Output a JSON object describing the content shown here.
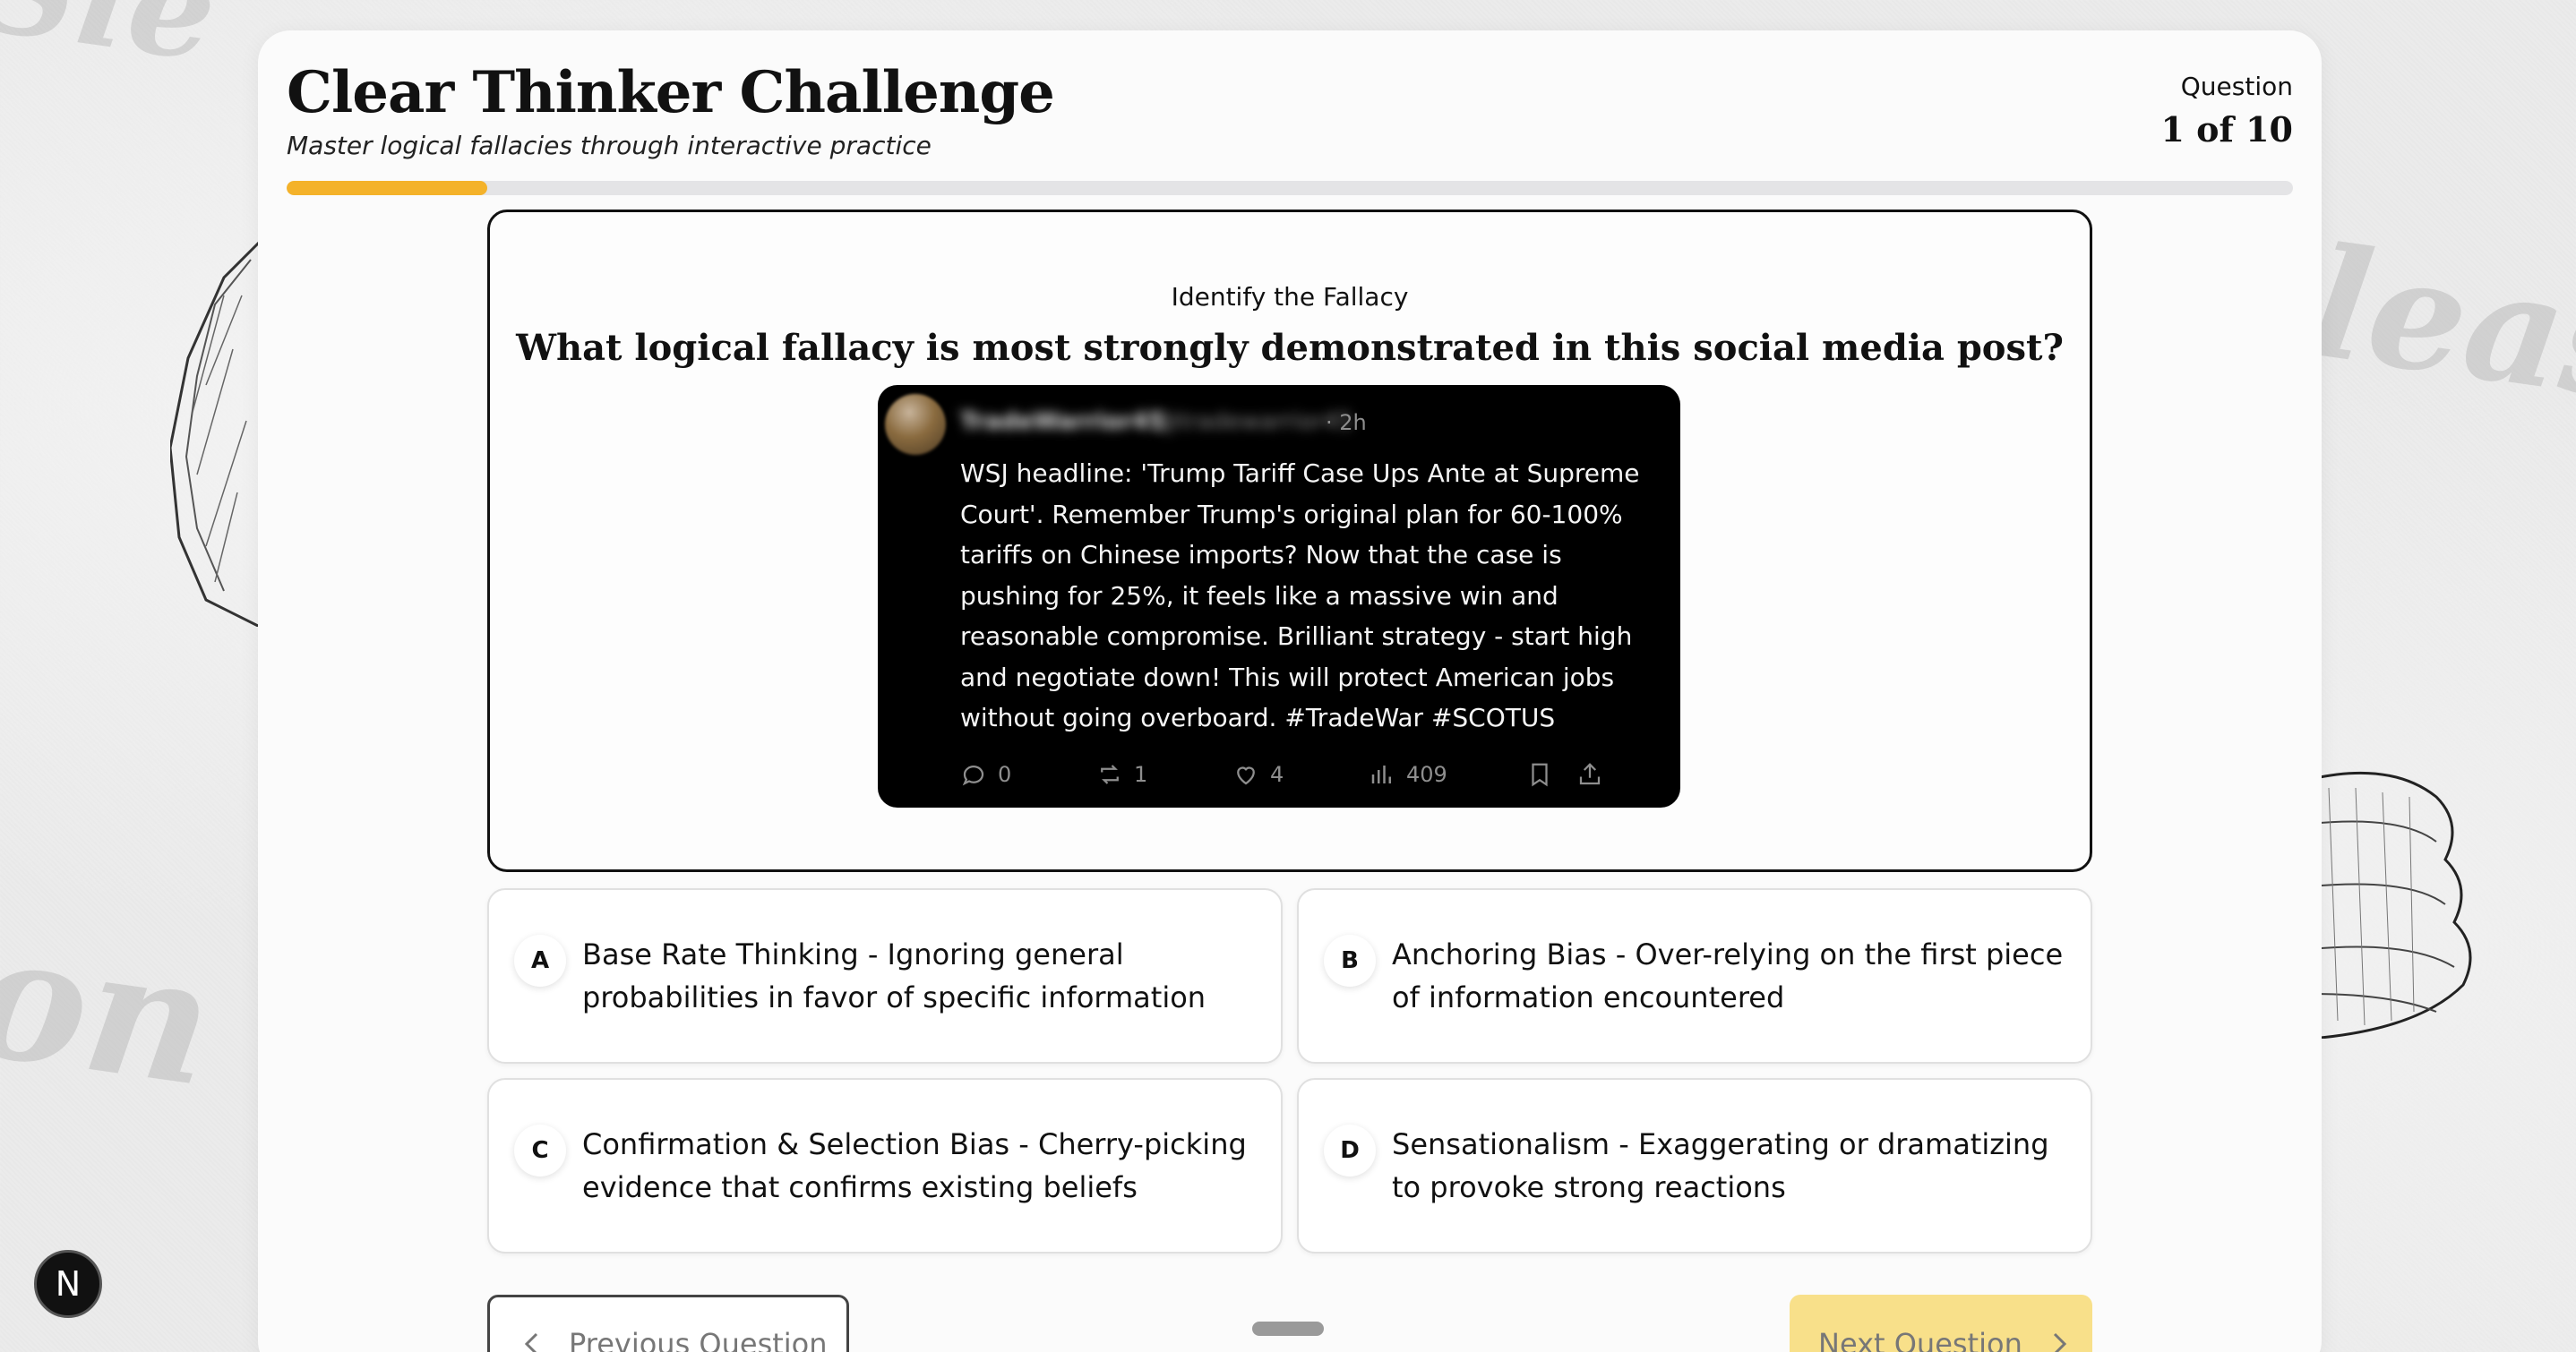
{
  "header": {
    "title": "Clear Thinker Challenge",
    "subtitle": "Master logical fallacies through interactive practice",
    "question_label": "Question",
    "question_count": "1 of 10",
    "progress_fraction": 0.1
  },
  "question": {
    "kicker": "Identify the Fallacy",
    "text": "What logical fallacy is most strongly demonstrated in this social media post?"
  },
  "post": {
    "display_name": "TradeWarrior45",
    "handle": "@tradewarrior45",
    "time": "· 2h",
    "text": "WSJ headline: 'Trump Tariff Case Ups Ante at Supreme Court'. Remember Trump's original plan for 60-100% tariffs on Chinese imports? Now that the case is pushing for 25%, it feels like a massive win and reasonable compromise. Brilliant strategy - start high and negotiate down! This will protect American jobs without going overboard. #TradeWar #SCOTUS",
    "replies": "0",
    "reposts": "1",
    "likes": "4",
    "views": "409"
  },
  "options": [
    {
      "letter": "A",
      "text": "Base Rate Thinking - Ignoring general probabilities in favor of specific information"
    },
    {
      "letter": "B",
      "text": "Anchoring Bias - Over-relying on the first piece of information encountered"
    },
    {
      "letter": "C",
      "text": "Confirmation & Selection Bias - Cherry-picking evidence that confirms existing beliefs"
    },
    {
      "letter": "D",
      "text": "Sensationalism - Exaggerating or dramatizing to provoke strong reactions"
    }
  ],
  "nav": {
    "prev_label": "Previous Question",
    "next_label": "Next Question"
  },
  "background": {
    "word_top": "Sle",
    "word_right": "lease",
    "word_left": "on S"
  },
  "badge": {
    "letter": "N"
  },
  "colors": {
    "accent": "#f4b22a",
    "next_button": "#f8e08a",
    "post_background": "#000000"
  }
}
